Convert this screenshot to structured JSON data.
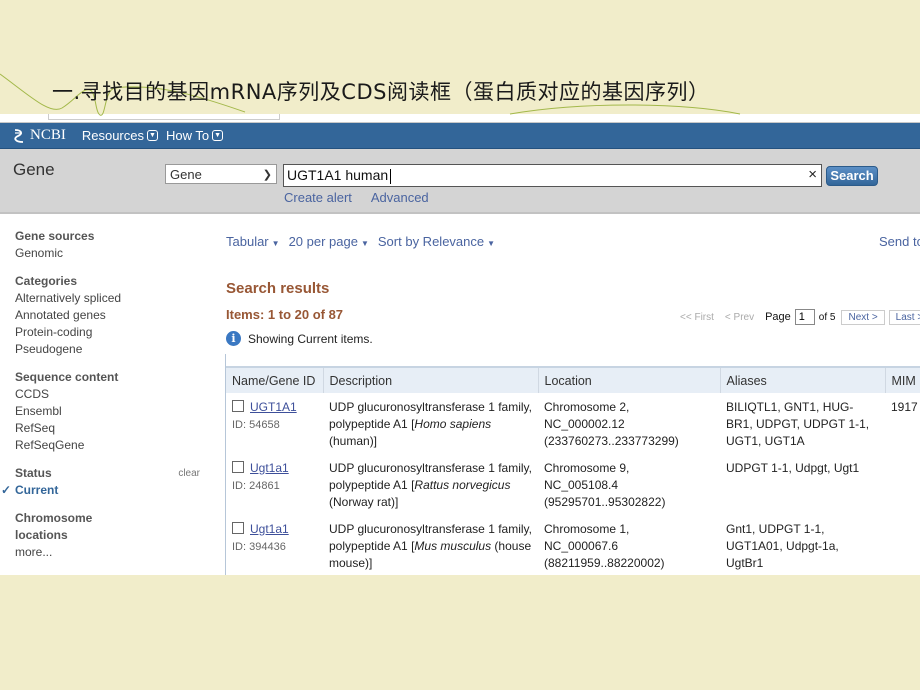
{
  "slide": {
    "title": "一.寻找目的基因mRNA序列及CDS阅读框（蛋白质对应的基因序列）"
  },
  "ncbi_bar": {
    "logo_text": "NCBI",
    "nav": [
      {
        "label": "Resources",
        "icon": "chevron-down-icon"
      },
      {
        "label": "How To",
        "icon": "chevron-down-icon"
      }
    ]
  },
  "search": {
    "db_title": "Gene",
    "db_select_value": "Gene",
    "term_value": "UGT1A1 human",
    "clear_icon": "×",
    "button_label": "Search",
    "links": [
      "Create alert",
      "Advanced"
    ]
  },
  "sidebar": {
    "groups": [
      {
        "heading": "Gene sources",
        "items": [
          "Genomic"
        ]
      },
      {
        "heading": "Categories",
        "items": [
          "Alternatively spliced",
          "Annotated genes",
          "Protein-coding",
          "Pseudogene"
        ]
      },
      {
        "heading": "Sequence content",
        "items": [
          "CCDS",
          "Ensembl",
          "RefSeq",
          "RefSeqGene"
        ]
      },
      {
        "heading": "Status",
        "clear_label": "clear",
        "items": [
          "Current"
        ],
        "active": "Current"
      },
      {
        "heading": "Chromosome locations",
        "items": [
          "more..."
        ]
      }
    ]
  },
  "toolbar": {
    "format": "Tabular",
    "per_page": "20 per page",
    "sort": "Sort by Relevance",
    "send_to": "Send to"
  },
  "results": {
    "title": "Search results",
    "count_text": "Items: 1 to 20 of 87",
    "info_text": "Showing Current items.",
    "pager": {
      "first": "<< First",
      "prev": "< Prev",
      "page_label": "Page",
      "page_value": "1",
      "of_text": "of 5",
      "next": "Next >",
      "last": "Last >>"
    },
    "columns": [
      "Name/Gene ID",
      "Description",
      "Location",
      "Aliases",
      "MIM"
    ],
    "rows": [
      {
        "name": "UGT1A1",
        "id": "ID: 54658",
        "desc_plain": "UDP glucuronosyltransferase 1 family, polypeptide A1 [",
        "desc_italic": "Homo sapiens",
        "desc_tail": " (human)]",
        "location": [
          "Chromosome 2,",
          "NC_000002.12",
          "(233760273..233773299)"
        ],
        "aliases": "BILIQTL1, GNT1, HUG-BR1, UDPGT, UDPGT 1-1, UGT1, UGT1A",
        "mim": "1917"
      },
      {
        "name": "Ugt1a1",
        "id": "ID: 24861",
        "desc_plain": "UDP glucuronosyltransferase 1 family, polypeptide A1 [",
        "desc_italic": "Rattus norvegicus",
        "desc_tail": " (Norway rat)]",
        "location": [
          "Chromosome 9,",
          "NC_005108.4",
          "(95295701..95302822)"
        ],
        "aliases": "UDPGT 1-1, Udpgt, Ugt1",
        "mim": ""
      },
      {
        "name": "Ugt1a1",
        "id": "ID: 394436",
        "desc_plain": "UDP glucuronosyltransferase 1 family, polypeptide A1 [",
        "desc_italic": "Mus musculus",
        "desc_tail": " (house mouse)]",
        "location": [
          "Chromosome 1,",
          "NC_000067.6",
          "(88211959..88220002)"
        ],
        "aliases": "Gnt1, UDPGT 1-1, UGT1A01, Udpgt-1a, UgtBr1",
        "mim": ""
      }
    ]
  }
}
